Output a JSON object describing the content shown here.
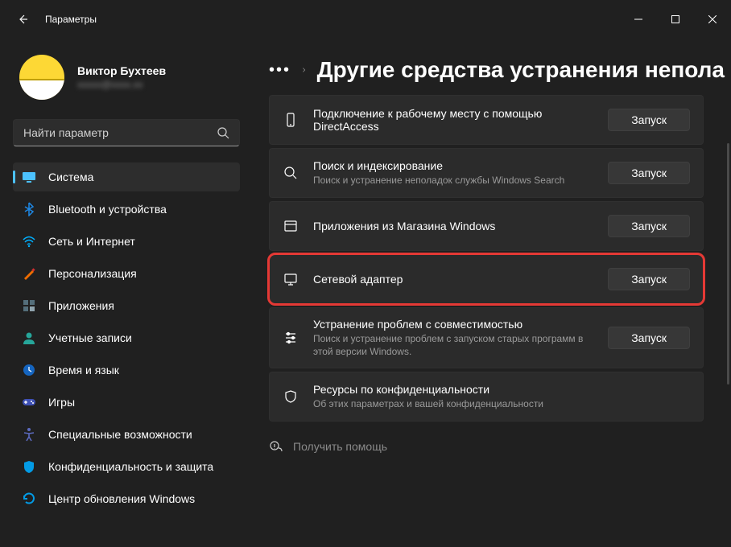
{
  "window": {
    "title": "Параметры"
  },
  "profile": {
    "name": "Виктор Бухтеев",
    "email": "xxxxx@xxxx.xx"
  },
  "search": {
    "placeholder": "Найти параметр"
  },
  "nav": [
    {
      "id": "system",
      "label": "Система",
      "selected": true,
      "color": "#4cc2ff"
    },
    {
      "id": "bluetooth",
      "label": "Bluetooth и устройства",
      "selected": false,
      "color": "#1e88e5"
    },
    {
      "id": "network",
      "label": "Сеть и Интернет",
      "selected": false,
      "color": "#00b0ff"
    },
    {
      "id": "personalization",
      "label": "Персонализация",
      "selected": false,
      "color": "#ef6c00"
    },
    {
      "id": "apps",
      "label": "Приложения",
      "selected": false,
      "color": "#546e7a"
    },
    {
      "id": "accounts",
      "label": "Учетные записи",
      "selected": false,
      "color": "#26a69a"
    },
    {
      "id": "time",
      "label": "Время и язык",
      "selected": false,
      "color": "#1565c0"
    },
    {
      "id": "gaming",
      "label": "Игры",
      "selected": false,
      "color": "#3f51b5"
    },
    {
      "id": "accessibility",
      "label": "Специальные возможности",
      "selected": false,
      "color": "#5c6bc0"
    },
    {
      "id": "privacy",
      "label": "Конфиденциальность и защита",
      "selected": false,
      "color": "#039be5"
    },
    {
      "id": "update",
      "label": "Центр обновления Windows",
      "selected": false,
      "color": "#039be5"
    }
  ],
  "breadcrumb": {
    "title": "Другие средства устранения непола"
  },
  "run_label": "Запуск",
  "cards": [
    {
      "id": "directaccess",
      "title": "Подключение к рабочему месту с помощью DirectAccess",
      "sub": "",
      "button": true,
      "highlighted": false,
      "icon": "phone"
    },
    {
      "id": "search",
      "title": "Поиск и индексирование",
      "sub": "Поиск и устранение неполадок службы Windows Search",
      "button": true,
      "highlighted": false,
      "icon": "search"
    },
    {
      "id": "store",
      "title": "Приложения из Магазина Windows",
      "sub": "",
      "button": true,
      "highlighted": false,
      "icon": "window"
    },
    {
      "id": "netadapter",
      "title": "Сетевой адаптер",
      "sub": "",
      "button": true,
      "highlighted": true,
      "icon": "monitor"
    },
    {
      "id": "compat",
      "title": "Устранение проблем с совместимостью",
      "sub": "Поиск и устранение проблем с запуском старых программ в этой версии Windows.",
      "button": true,
      "highlighted": false,
      "icon": "sliders"
    },
    {
      "id": "privacy-res",
      "title": "Ресурсы по конфиденциальности",
      "sub": "Об этих параметрах и вашей конфиденциальности",
      "button": false,
      "highlighted": false,
      "icon": "shield"
    }
  ],
  "help": {
    "label": "Получить помощь"
  }
}
